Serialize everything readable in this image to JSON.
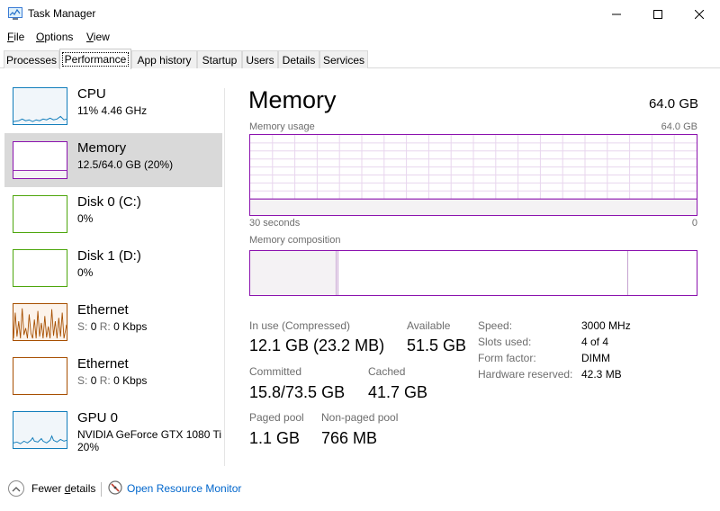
{
  "window": {
    "title": "Task Manager",
    "icon": "task-manager-icon",
    "controls": [
      "minimize-icon",
      "maximize-icon",
      "close-icon"
    ]
  },
  "menu": {
    "file": {
      "accel": "F",
      "rest": "ile"
    },
    "options": {
      "accel": "O",
      "rest": "ptions"
    },
    "view": {
      "accel": "V",
      "rest": "iew"
    }
  },
  "tabs": [
    "Processes",
    "Performance",
    "App history",
    "Startup",
    "Users",
    "Details",
    "Services"
  ],
  "active_tab": "Performance",
  "sidebar": {
    "items": [
      {
        "name": "CPU",
        "sub": "11%  4.46 GHz",
        "color": "#117dbb"
      },
      {
        "name": "Memory",
        "sub": "12.5/64.0 GB (20%)",
        "color": "#8b12ae"
      },
      {
        "name": "Disk 0 (C:)",
        "sub": "0%",
        "color": "#4da60c"
      },
      {
        "name": "Disk 1 (D:)",
        "sub": "0%",
        "color": "#4da60c"
      },
      {
        "name": "Ethernet",
        "sub_label1": "S:",
        "sub_val1": "0",
        "sub_label2": "R:",
        "sub_val2": "0 Kbps",
        "color": "#a74f01"
      },
      {
        "name": "Ethernet",
        "sub_label1": "S:",
        "sub_val1": "0",
        "sub_label2": "R:",
        "sub_val2": "0 Kbps",
        "color": "#a74f01"
      },
      {
        "name": "GPU 0",
        "sub": "NVIDIA GeForce GTX 1080 Ti",
        "sub2": "20%",
        "color": "#117dbb"
      }
    ],
    "selected": 1
  },
  "main": {
    "title": "Memory",
    "total": "64.0 GB",
    "usage_label": "Memory usage",
    "usage_max": "64.0 GB",
    "time_left": "30 seconds",
    "time_right": "0",
    "composition_label": "Memory composition",
    "usage_fraction": 0.2,
    "stats": {
      "in_use_label": "In use (Compressed)",
      "in_use_value": "12.1 GB (23.2 MB)",
      "available_label": "Available",
      "available_value": "51.5 GB",
      "committed_label": "Committed",
      "committed_value": "15.8/73.5 GB",
      "cached_label": "Cached",
      "cached_value": "41.7 GB",
      "paged_label": "Paged pool",
      "paged_value": "1.1 GB",
      "nonpaged_label": "Non-paged pool",
      "nonpaged_value": "766 MB"
    },
    "specs": [
      {
        "label": "Speed:",
        "value": "3000 MHz"
      },
      {
        "label": "Slots used:",
        "value": "4 of 4"
      },
      {
        "label": "Form factor:",
        "value": "DIMM"
      },
      {
        "label": "Hardware reserved:",
        "value": "42.3 MB"
      }
    ],
    "accent": "#8b12ae"
  },
  "footer": {
    "fewer_details": "Fewer details",
    "fewer_accel": "d",
    "open_monitor": "Open Resource Monitor"
  }
}
